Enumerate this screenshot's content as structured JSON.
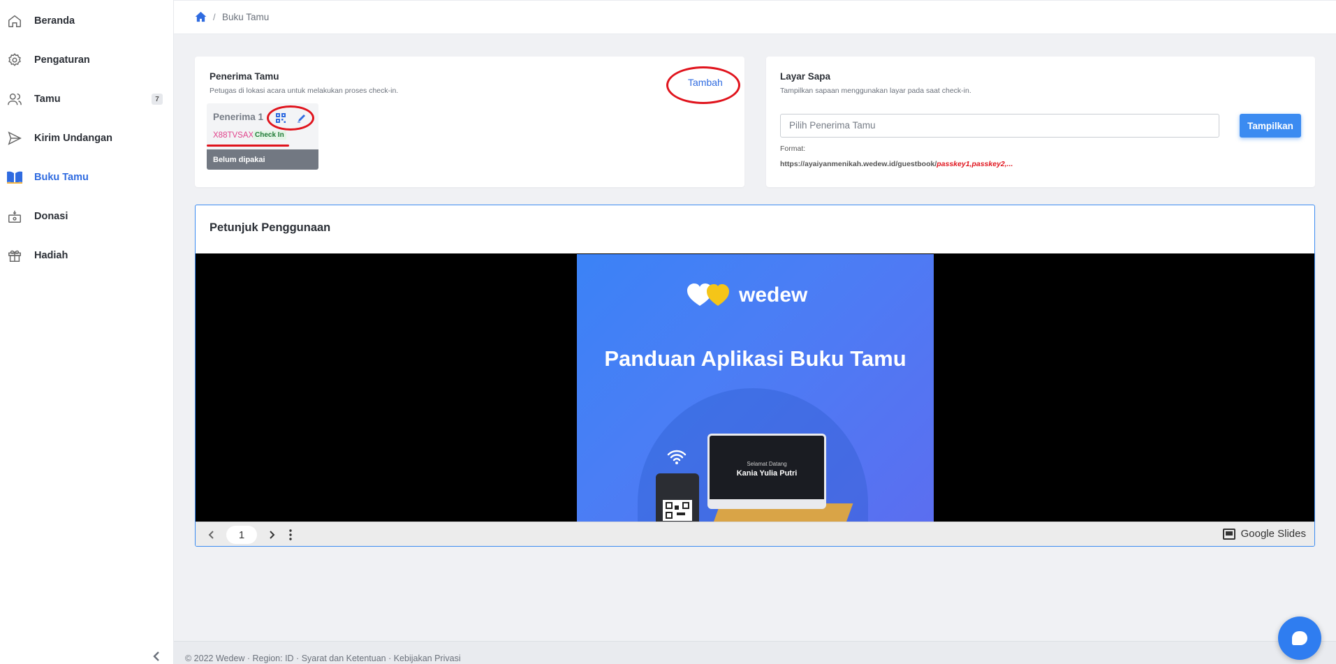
{
  "sidebar": {
    "items": [
      {
        "label": "Beranda",
        "icon": "home-icon"
      },
      {
        "label": "Pengaturan",
        "icon": "gear-icon"
      },
      {
        "label": "Tamu",
        "icon": "users-icon",
        "badge": "7"
      },
      {
        "label": "Kirim Undangan",
        "icon": "send-icon"
      },
      {
        "label": "Buku Tamu",
        "icon": "book-icon",
        "active": true
      },
      {
        "label": "Donasi",
        "icon": "donation-icon"
      },
      {
        "label": "Hadiah",
        "icon": "gift-icon"
      }
    ]
  },
  "breadcrumb": {
    "separator": "/",
    "current": "Buku Tamu"
  },
  "receivers_card": {
    "title": "Penerima Tamu",
    "subtitle": "Petugas di lokasi acara untuk melakukan proses check-in.",
    "add_label": "Tambah",
    "receiver": {
      "name": "Penerima 1",
      "code": "X88TVSAX",
      "badge": "Check In",
      "status": "Belum dipakai"
    }
  },
  "greeting_card": {
    "title": "Layar Sapa",
    "subtitle": "Tampilkan sapaan menggunakan layar pada saat check-in.",
    "select_placeholder": "Pilih Penerima Tamu",
    "button_label": "Tampilkan",
    "format_label": "Format:",
    "format_url_base": "https://ayaiyanmenikah.wedew.id/guestbook/",
    "format_url_keys": "passkey1,passkey2,...",
    "format_url_suffix": ""
  },
  "guide": {
    "title": "Petunjuk Penggunaan",
    "slide": {
      "logo_text": "wedew",
      "title": "Panduan Aplikasi Buku Tamu",
      "screen_sub": "Selamat Datang",
      "screen_name": "Kania Yulia Putri"
    },
    "viewer": {
      "page": "1",
      "brand": "Google Slides"
    }
  },
  "footer": {
    "text": "© 2022 Wedew · Region: ID · Syarat dan Ketentuan · Kebijakan Privasi"
  },
  "colors": {
    "accent": "#2f6be0",
    "annotation": "#e0141d",
    "button": "#3b8bf1"
  }
}
